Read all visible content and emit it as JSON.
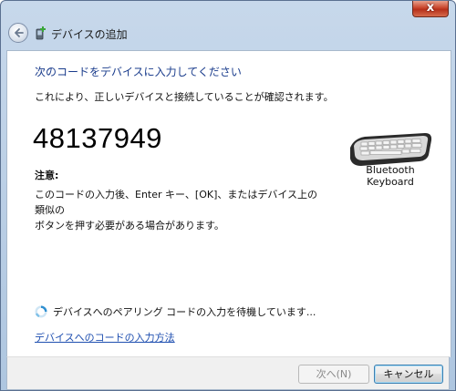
{
  "window": {
    "title": "デバイスの追加",
    "close_glyph": "x"
  },
  "content": {
    "instruction": "次のコードをデバイスに入力してください",
    "description": "これにより、正しいデバイスと接続していることが確認されます。",
    "pairing_code": "48137949",
    "note_title": "注意:",
    "note_line1": "このコードの入力後、Enter キー、[OK]、またはデバイス上の類似の",
    "note_line2": "ボタンを押す必要がある場合があります。",
    "device_label": "Bluetooth Keyboard",
    "status_text": "デバイスへのペアリング コードの入力を待機しています...",
    "help_link": "デバイスへのコードの入力方法"
  },
  "footer": {
    "next_label": "次へ(N)",
    "cancel_label": "キャンセル"
  },
  "icons": {
    "back": "back-arrow-icon",
    "title": "add-device-icon",
    "device": "keyboard-icon",
    "spinner": "busy-spinner-icon"
  },
  "colors": {
    "instruction": "#1a3c8c",
    "link": "#1f4fb0",
    "close_button": "#c8452c"
  }
}
